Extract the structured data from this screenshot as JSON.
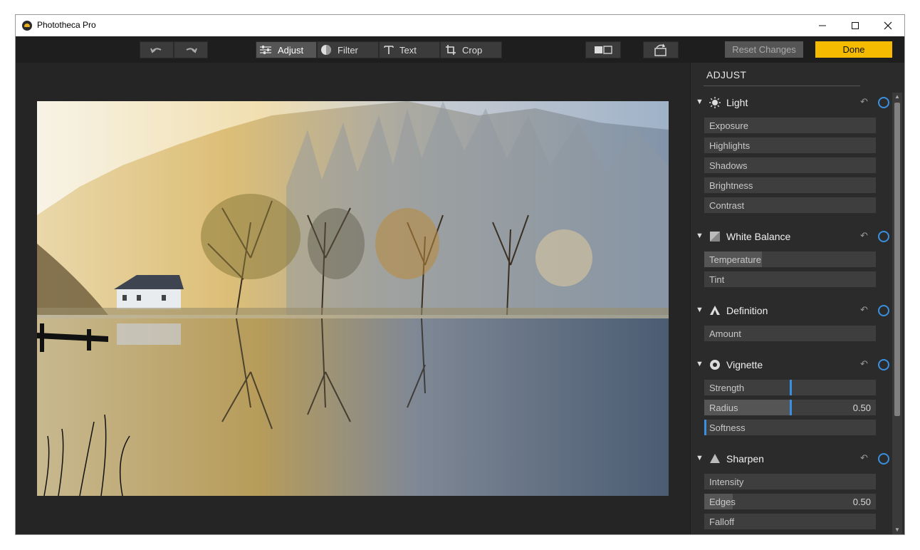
{
  "window": {
    "title": "Phototheca Pro"
  },
  "toolbar": {
    "undo_icon": "undo-icon",
    "redo_icon": "redo-icon",
    "tabs": [
      {
        "label": "Adjust",
        "icon": "sliders-icon",
        "active": true
      },
      {
        "label": "Filter",
        "icon": "filter-icon",
        "active": false
      },
      {
        "label": "Text",
        "icon": "text-icon",
        "active": false
      },
      {
        "label": "Crop",
        "icon": "crop-icon",
        "active": false
      }
    ],
    "compare_icon": "compare-icon",
    "rotate_icon": "rotate-icon",
    "reset_label": "Reset Changes",
    "done_label": "Done"
  },
  "panel": {
    "title": "ADJUST",
    "sections": [
      {
        "name": "Light",
        "icon": "sun-icon",
        "sliders": [
          {
            "label": "Exposure"
          },
          {
            "label": "Highlights"
          },
          {
            "label": "Shadows"
          },
          {
            "label": "Brightness"
          },
          {
            "label": "Contrast"
          }
        ]
      },
      {
        "name": "White Balance",
        "icon": "white-balance-icon",
        "sliders": [
          {
            "label": "Temperature"
          },
          {
            "label": "Tint"
          }
        ]
      },
      {
        "name": "Definition",
        "icon": "definition-icon",
        "sliders": [
          {
            "label": "Amount"
          }
        ]
      },
      {
        "name": "Vignette",
        "icon": "vignette-icon",
        "sliders": [
          {
            "label": "Strength"
          },
          {
            "label": "Radius",
            "value": "0.50"
          },
          {
            "label": "Softness"
          }
        ]
      },
      {
        "name": "Sharpen",
        "icon": "sharpen-icon",
        "sliders": [
          {
            "label": "Intensity"
          },
          {
            "label": "Edges",
            "value": "0.50"
          },
          {
            "label": "Falloff"
          }
        ]
      }
    ]
  },
  "colors": {
    "accent": "#3a8fe0",
    "done": "#f5bb00",
    "background": "#1e1e1e"
  }
}
